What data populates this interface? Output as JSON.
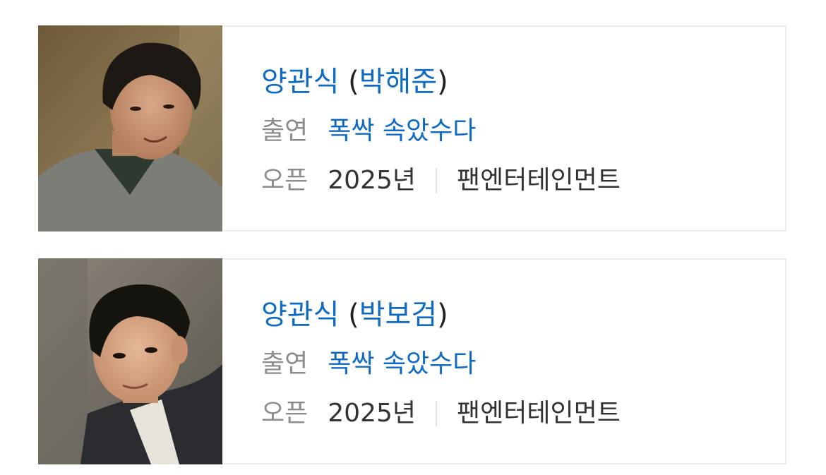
{
  "cards": [
    {
      "role": "양관식",
      "actor": "박해준",
      "appearance_label": "출연",
      "show_title": "폭싹 속았수다",
      "open_label": "오픈",
      "year": "2025년",
      "agency": "팬엔터테인먼트"
    },
    {
      "role": "양관식",
      "actor": "박보검",
      "appearance_label": "출연",
      "show_title": "폭싹 속았수다",
      "open_label": "오픈",
      "year": "2025년",
      "agency": "팬엔터테인먼트"
    }
  ],
  "colors": {
    "link": "#0f6ac4",
    "label": "#8c8c8c",
    "text": "#333333",
    "border": "#ececec"
  }
}
